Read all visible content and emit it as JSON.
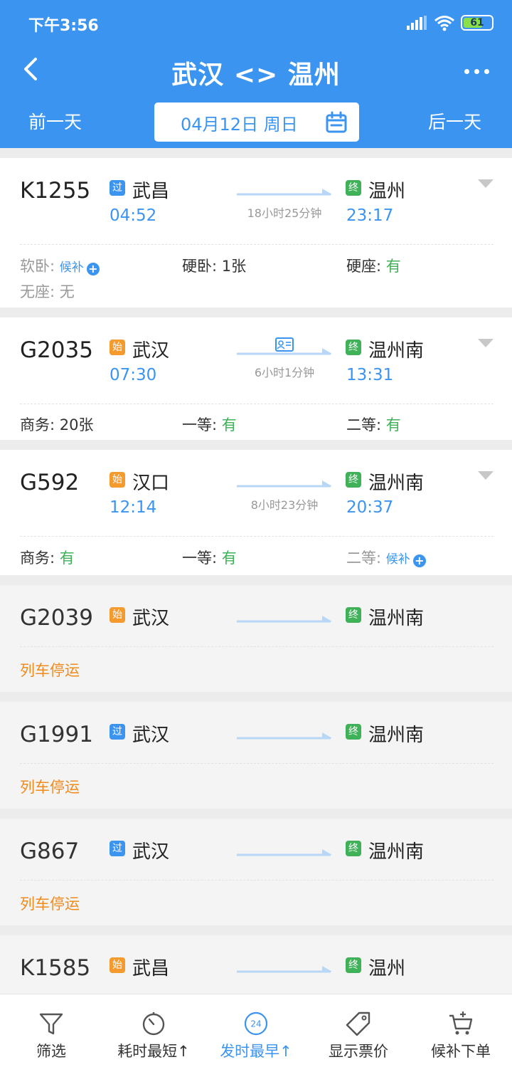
{
  "status": {
    "time": "下午3:56",
    "battery": "61"
  },
  "header": {
    "title": "武汉 <> 温州",
    "prev_day": "前一天",
    "next_day": "后一天",
    "date": "04月12日 周日"
  },
  "trains": [
    {
      "no": "K1255",
      "from_badge": "过",
      "from": "武昌",
      "dep": "04:52",
      "to_badge": "终",
      "to": "温州",
      "arr": "23:17",
      "duration": "18小时25分钟",
      "seats": [
        {
          "label": "软卧:",
          "value": "",
          "wait": "候补"
        },
        {
          "label": "硬卧:",
          "value": "1张"
        },
        {
          "label": "硬座:",
          "value": "有"
        },
        {
          "label": "无座:",
          "value": "无"
        }
      ]
    },
    {
      "no": "G2035",
      "from_badge": "始",
      "from": "武汉",
      "dep": "07:30",
      "to_badge": "终",
      "to": "温州南",
      "arr": "13:31",
      "duration": "6小时1分钟",
      "seats": [
        {
          "label": "商务:",
          "value": "20张"
        },
        {
          "label": "一等:",
          "value": "有"
        },
        {
          "label": "二等:",
          "value": "有"
        }
      ]
    },
    {
      "no": "G592",
      "from_badge": "始",
      "from": "汉口",
      "dep": "12:14",
      "to_badge": "终",
      "to": "温州南",
      "arr": "20:37",
      "duration": "8小时23分钟",
      "seats": [
        {
          "label": "商务:",
          "value": "有"
        },
        {
          "label": "一等:",
          "value": "有"
        },
        {
          "label": "二等:",
          "value": "",
          "wait": "候补"
        }
      ]
    },
    {
      "no": "G2039",
      "from_badge": "始",
      "from": "武汉",
      "to_badge": "终",
      "to": "温州南",
      "status": "列车停运"
    },
    {
      "no": "G1991",
      "from_badge": "过",
      "from": "武汉",
      "to_badge": "终",
      "to": "温州南",
      "status": "列车停运"
    },
    {
      "no": "G867",
      "from_badge": "过",
      "from": "武汉",
      "to_badge": "终",
      "to": "温州南",
      "status": "列车停运"
    },
    {
      "no": "K1585",
      "from_badge": "始",
      "from": "武昌",
      "to_badge": "终",
      "to": "温州"
    }
  ],
  "tabs": [
    {
      "label": "筛选",
      "icon": "filter-icon"
    },
    {
      "label": "耗时最短↑",
      "icon": "timer-icon"
    },
    {
      "label": "发时最早↑",
      "icon": "clock-24-icon",
      "icon_text": "24"
    },
    {
      "label": "显示票价",
      "icon": "price-tag-icon"
    },
    {
      "label": "候补下单",
      "icon": "cart-plus-icon"
    }
  ],
  "colors": {
    "primary": "#3b94f0",
    "available": "#3fb158",
    "stopped": "#f08a1c",
    "start_badge": "#f59a2c",
    "end_badge": "#3fb158"
  }
}
